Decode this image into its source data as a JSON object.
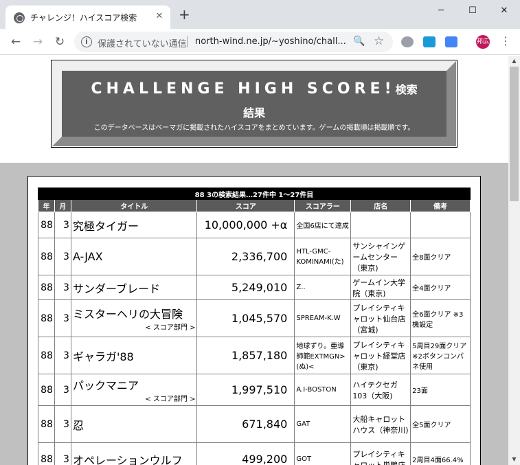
{
  "browser": {
    "tab_title": "チャレンジ！ハイスコア検索",
    "tab_close": "✕",
    "new_tab": "+",
    "win_min": "─",
    "win_max": "☐",
    "win_close": "✕",
    "back": "←",
    "forward": "→",
    "reload": "↻",
    "security_text": "保護されていない通信",
    "url": "north-wind.ne.jp/~yoshino/chall...",
    "profile_label": "邦広",
    "menu": "⋮",
    "info": "i",
    "zoom": "🔍",
    "star": "☆",
    "scroll_up": "▲",
    "scroll_down": "▼"
  },
  "header": {
    "title_main": "CHALLENGE HIGH SCORE!",
    "title_suffix": "検索",
    "title_line2": "結果",
    "description": "このデータベースはベーマガに掲載されたハイスコアをまとめています。ゲームの掲載順は掲載順です。"
  },
  "results": {
    "caption": "88 3の検索結果…27件中 1～27件目",
    "columns": [
      "年",
      "月",
      "タイトル",
      "スコア",
      "スコアラー",
      "店名",
      "備考"
    ],
    "rows": [
      {
        "year": "88",
        "month": "3",
        "title": "究極タイガー",
        "sub": "",
        "score": "10,000,000 +α",
        "player": "全国6店にて達成",
        "store": "",
        "note": ""
      },
      {
        "year": "88",
        "month": "3",
        "title": "A-JAX",
        "sub": "",
        "score": "2,336,700",
        "player": "HTL-GMC-KOMINAMI(た)",
        "store": "サンシャインゲームセンター（東京)",
        "note": "全8面クリア"
      },
      {
        "year": "88",
        "month": "3",
        "title": "サンダーブレード",
        "sub": "",
        "score": "5,249,010",
        "player": "Z..",
        "store": "ゲームイン大学院（東京)",
        "note": "全4面クリア"
      },
      {
        "year": "88",
        "month": "3",
        "title": "ミスターヘリの大冒険",
        "sub": "< スコア部門 >",
        "score": "1,045,570",
        "player": "SPREAM-K.W",
        "store": "プレイシティキャロット仙台店（宮城)",
        "note": "全6面クリア ※3機設定"
      },
      {
        "year": "88",
        "month": "3",
        "title": "ギャラガ'88",
        "sub": "",
        "score": "1,857,180",
        "player": "地球ずり。亜導師範EXTMGN>(ぬ)<",
        "store": "プレイシティキャロット経堂店（東京)",
        "note": "5周目29面クリア ※2ボタンコンパネ使用"
      },
      {
        "year": "88",
        "month": "3",
        "title": "パックマニア",
        "sub": "< スコア部門 >",
        "score": "1,997,510",
        "player": "A.I-BOSTON",
        "store": "ハイテクセガ103（大阪)",
        "note": "23面"
      },
      {
        "year": "88",
        "month": "3",
        "title": "忍",
        "sub": "",
        "score": "671,840",
        "player": "GAT",
        "store": "大船キャロットハウス（神奈川)",
        "note": "全5面クリア"
      },
      {
        "year": "88",
        "month": "3",
        "title": "オペレーションウルフ",
        "sub": "",
        "score": "499,200",
        "player": "GOT",
        "store": "プレイシティキャロット巣鴨店",
        "note": "2周目4面66.4%"
      }
    ]
  },
  "colors": {
    "banner_bg": "#606060",
    "page_bg": "#c0c0c0",
    "table_head": "#5a5a5a",
    "profile": "#c2185b"
  }
}
